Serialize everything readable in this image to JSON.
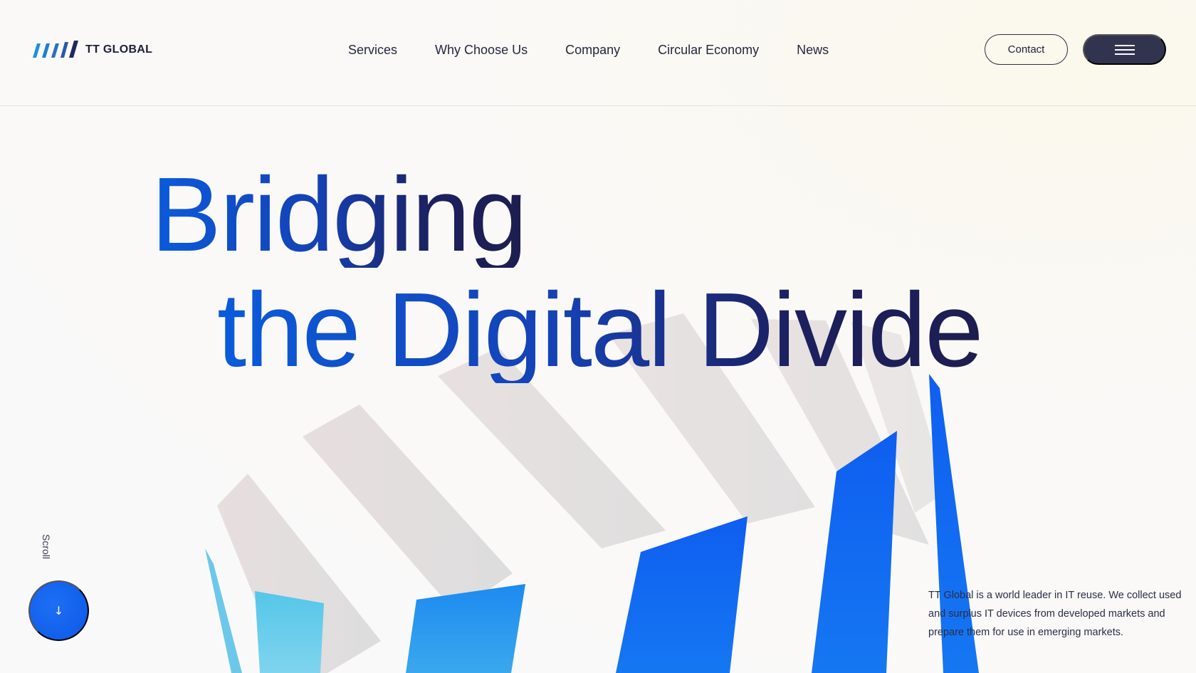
{
  "brand": {
    "name": "TT GLOBAL",
    "logo_icon": "stripes-logo-icon"
  },
  "nav": {
    "items": [
      "Services",
      "Why Choose Us",
      "Company",
      "Circular Economy",
      "News"
    ]
  },
  "header": {
    "contact_label": "Contact",
    "menu_icon": "hamburger-menu-icon"
  },
  "hero": {
    "headline_line1": "Bridging",
    "headline_line2": "the Digital Divide",
    "intro": "TT Global is a world leader in IT reuse. We collect used and surplus IT devices from developed markets and prepare them for use in emerging markets."
  },
  "scroll": {
    "label": "Scroll",
    "icon": "arrow-down-icon"
  },
  "colors": {
    "accent_blue": "#0c58e6",
    "navy": "#1d1d4f",
    "menu_button": "#32344f"
  }
}
